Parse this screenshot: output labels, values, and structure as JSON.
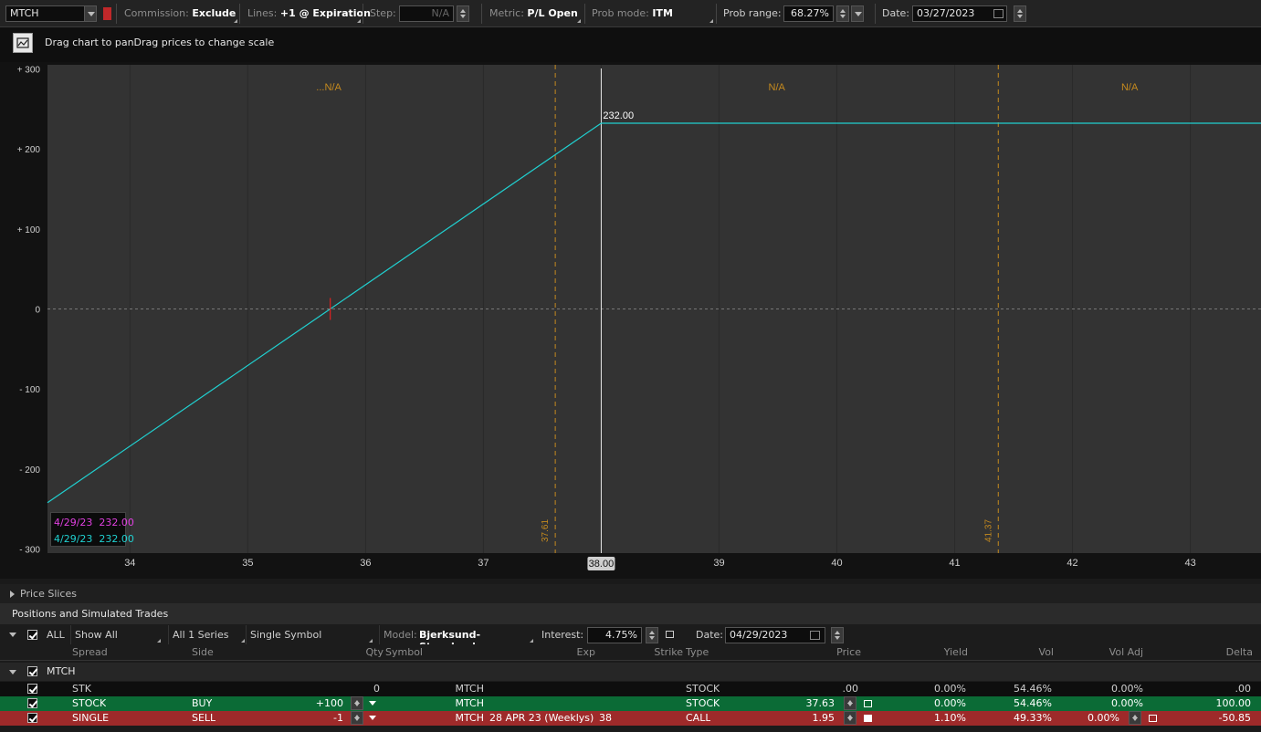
{
  "toolbar": {
    "symbol": "MTCH",
    "commission_label": "Commission:",
    "commission_value": "Exclude",
    "lines_label": "Lines:",
    "lines_value": "+1 @ Expiration",
    "step_label": "Step:",
    "step_value": "N/A",
    "metric_label": "Metric:",
    "metric_value": "P/L Open",
    "prob_mode_label": "Prob mode:",
    "prob_mode_value": "ITM",
    "prob_range_label": "Prob range:",
    "prob_range_value": "68.27%",
    "date_label": "Date:",
    "date_value": "03/27/2023"
  },
  "hint": {
    "text": "Drag chart to panDrag prices to change scale"
  },
  "chart": {
    "y_ticks": [
      "+ 300",
      "+ 200",
      "+ 100",
      "0",
      "- 100",
      "- 200",
      "- 300"
    ],
    "x_ticks": [
      "34",
      "35",
      "36",
      "37",
      "38",
      "39",
      "40",
      "41",
      "42",
      "43"
    ],
    "current_price_label": "38.00",
    "line_value_label": "232.00",
    "band_low_label": "37.61",
    "band_high_label": "41.37",
    "zone_labels": [
      "...N/A",
      "N/A",
      "N/A"
    ],
    "legend": [
      {
        "date": "4/29/23",
        "value": "232.00",
        "color": "#e040e0"
      },
      {
        "date": "4/29/23",
        "value": "232.00",
        "color": "#20d0d0"
      }
    ]
  },
  "chart_data": {
    "type": "line",
    "xlim": [
      33.3,
      43.6
    ],
    "ylim": [
      -305,
      305
    ],
    "series": [
      {
        "name": "4/29/23",
        "x": [
          33.3,
          35.7,
          38.0,
          43.6
        ],
        "y": [
          -242,
          0,
          232,
          232
        ]
      }
    ],
    "reference_x": [
      37.61,
      41.37
    ],
    "current_x": 38.0,
    "grid": true
  },
  "panels": {
    "price_slices": "Price Slices",
    "positions_title": "Positions and Simulated Trades"
  },
  "controls": {
    "all_label": "ALL",
    "show_all": "Show All",
    "series": "All 1 Series",
    "single_symbol": "Single Symbol",
    "model_label": "Model:",
    "model_value": "Bjerksund-Stensland",
    "interest_label": "Interest:",
    "interest_value": "4.75%",
    "date_label": "Date:",
    "date_value": "04/29/2023"
  },
  "columns": {
    "spread": "Spread",
    "side": "Side",
    "qty": "Qty",
    "symbol": "Symbol",
    "exp": "Exp",
    "strike": "Strike",
    "type": "Type",
    "price": "Price",
    "yield": "Yield",
    "vol": "Vol",
    "vol_adj": "Vol Adj",
    "delta": "Delta"
  },
  "group": {
    "name": "MTCH"
  },
  "rows": [
    {
      "spread": "STK",
      "side": "",
      "qty": "0",
      "symbol": "MTCH",
      "exp": "",
      "strike": "",
      "type": "STOCK",
      "price": ".00",
      "yield": "0.00%",
      "vol": "54.46%",
      "vol_adj": "0.00%",
      "delta": ".00"
    },
    {
      "spread": "STOCK",
      "side": "BUY",
      "qty": "+100",
      "symbol": "MTCH",
      "exp": "",
      "strike": "",
      "type": "STOCK",
      "price": "37.63",
      "yield": "0.00%",
      "vol": "54.46%",
      "vol_adj": "0.00%",
      "delta": "100.00"
    },
    {
      "spread": "SINGLE",
      "side": "SELL",
      "qty": "-1",
      "symbol": "MTCH",
      "exp": "28 APR 23 (Weeklys)",
      "strike": "38",
      "type": "CALL",
      "price": "1.95",
      "yield": "1.10%",
      "vol": "49.33%",
      "vol_adj": "0.00%",
      "delta": "-50.85"
    }
  ]
}
